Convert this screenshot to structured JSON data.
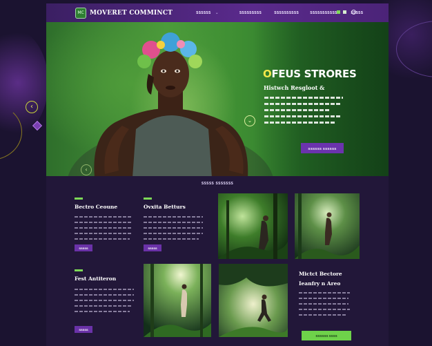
{
  "header": {
    "logo_text": "MC",
    "brand": "MOVERET COMMINCT",
    "nav": [
      "SSSSSS",
      "SSSSSSSSS",
      "SSSSSSSSSS",
      "SSSSSSSSSSSS",
      "SSSSS"
    ],
    "nav_chevron": "⌄"
  },
  "hero": {
    "title_first": "O",
    "title_rest": "FEUS STRORES",
    "subtitle": "Histwch Resgloot &",
    "button": "SSSSSS SSSSSS",
    "arrow_right": "⌄",
    "arrow_left": "‹"
  },
  "side": {
    "arrow": "‹"
  },
  "section": {
    "heading": "SSSSS SSSSSSS"
  },
  "cards": [
    {
      "title": "Bectro Ceoune",
      "button": "SSSSS"
    },
    {
      "title": "Ovxita Betturs",
      "button": "SSSSS"
    },
    {
      "title": "Fest Antiteron",
      "button": "SSSSS"
    },
    {
      "title_line1": "Mictct Bectore",
      "title_line2": "Ieanfry n Areo",
      "button": "SSSSSS SSSS"
    }
  ],
  "colors": {
    "header_bg": "#4b2378",
    "accent_purple": "#6b33ad",
    "accent_green": "#6ed24a",
    "page_bg": "#221739"
  }
}
